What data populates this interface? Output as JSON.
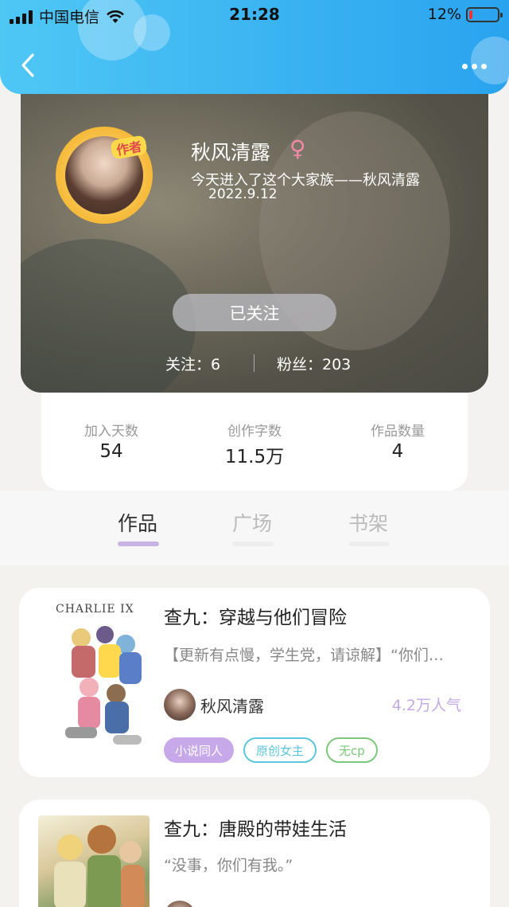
{
  "status_bar": {
    "carrier": "中国电信",
    "time": "21:28",
    "battery": "12%",
    "battery_level": 0.12
  },
  "colors": {
    "header_accent": "#2aa3ef",
    "tab_indicator": "#c9b3e4",
    "popularity": "#c5a9e6"
  },
  "profile": {
    "author_badge": "作者",
    "username": "秋风清露",
    "gender_symbol": "♀",
    "join_line": "今天进入了这个大家族——秋风清露",
    "join_date": "2022.9.12",
    "follow_button": "已关注",
    "following": "关注：6",
    "fans": "粉丝：203"
  },
  "stats": [
    {
      "label": "加入天数",
      "value": "54"
    },
    {
      "label": "创作字数",
      "value": "11.5万"
    },
    {
      "label": "作品数量",
      "value": "4"
    }
  ],
  "tabs": [
    {
      "label": "作品",
      "active": true
    },
    {
      "label": "广场",
      "active": false
    },
    {
      "label": "书架",
      "active": false
    }
  ],
  "works": [
    {
      "cover_title": "CHARLIE IX",
      "title": "查九：穿越与他们冒险",
      "description": "【更新有点慢，学生党，请谅解】“你们…",
      "author": "秋风清露",
      "popularity": "4.2万人气",
      "tags": [
        "小说同人",
        "原创女主",
        "无cp"
      ]
    },
    {
      "title": "查九：唐殿的带娃生活",
      "description": "“没事，你们有我。”"
    }
  ]
}
